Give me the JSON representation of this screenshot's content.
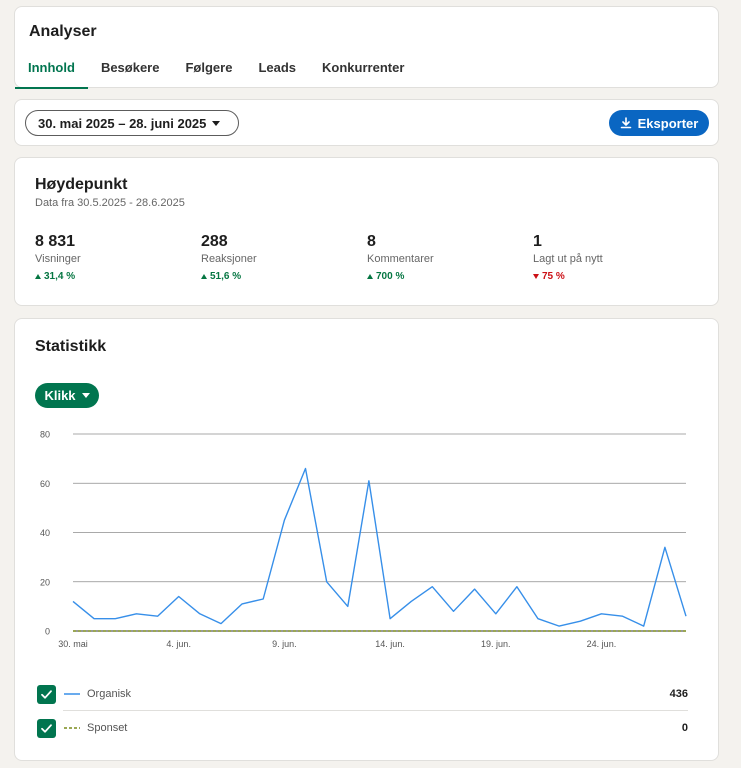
{
  "header": {
    "title": "Analyser",
    "tabs": [
      {
        "label": "Innhold",
        "active": true
      },
      {
        "label": "Besøkere",
        "active": false
      },
      {
        "label": "Følgere",
        "active": false
      },
      {
        "label": "Leads",
        "active": false
      },
      {
        "label": "Konkurrenter",
        "active": false
      }
    ]
  },
  "filter": {
    "date_range": "30. mai 2025 – 28. juni 2025",
    "export_label": "Eksporter"
  },
  "highlights": {
    "title": "Høydepunkt",
    "subtitle": "Data fra 30.5.2025 - 28.6.2025",
    "metrics": [
      {
        "value": "8 831",
        "label": "Visninger",
        "delta": "31,4 %",
        "direction": "up"
      },
      {
        "value": "288",
        "label": "Reaksjoner",
        "delta": "51,6 %",
        "direction": "up"
      },
      {
        "value": "8",
        "label": "Kommentarer",
        "delta": "700 %",
        "direction": "up"
      },
      {
        "value": "1",
        "label": "Lagt ut på nytt",
        "delta": "75 %",
        "direction": "down"
      }
    ]
  },
  "stats": {
    "title": "Statistikk",
    "metric_selector": "Klikk"
  },
  "colors": {
    "accent_green": "#01754f",
    "organic_line": "#378fe9",
    "sponsored_line": "#7a8b1b",
    "export_blue": "#0a66c2"
  },
  "chart_data": {
    "type": "line",
    "x": [
      "30. mai",
      "31. mai",
      "1. jun.",
      "2. jun.",
      "3. jun.",
      "4. jun.",
      "5. jun.",
      "6. jun.",
      "7. jun.",
      "8. jun.",
      "9. jun.",
      "10. jun.",
      "11. jun.",
      "12. jun.",
      "13. jun.",
      "14. jun.",
      "15. jun.",
      "16. jun.",
      "17. jun.",
      "18. jun.",
      "19. jun.",
      "20. jun.",
      "21. jun.",
      "22. jun.",
      "23. jun.",
      "24. jun.",
      "25. jun.",
      "26. jun.",
      "27. jun.",
      "28. jun."
    ],
    "x_tick_labels": [
      "30. mai",
      "4. jun.",
      "9. jun.",
      "14. jun.",
      "19. jun.",
      "24. jun."
    ],
    "ylim": [
      0,
      80
    ],
    "y_ticks": [
      0,
      20,
      40,
      60,
      80
    ],
    "grid": true,
    "series": [
      {
        "name": "Organisk",
        "total": "436",
        "style": "solid",
        "values": [
          12,
          5,
          5,
          7,
          6,
          14,
          7,
          3,
          11,
          13,
          45,
          66,
          20,
          10,
          61,
          5,
          12,
          18,
          8,
          17,
          7,
          18,
          5,
          2,
          4,
          7,
          6,
          2,
          34,
          6
        ]
      },
      {
        "name": "Sponset",
        "total": "0",
        "style": "dashed",
        "values": [
          0,
          0,
          0,
          0,
          0,
          0,
          0,
          0,
          0,
          0,
          0,
          0,
          0,
          0,
          0,
          0,
          0,
          0,
          0,
          0,
          0,
          0,
          0,
          0,
          0,
          0,
          0,
          0,
          0,
          0
        ]
      }
    ]
  }
}
